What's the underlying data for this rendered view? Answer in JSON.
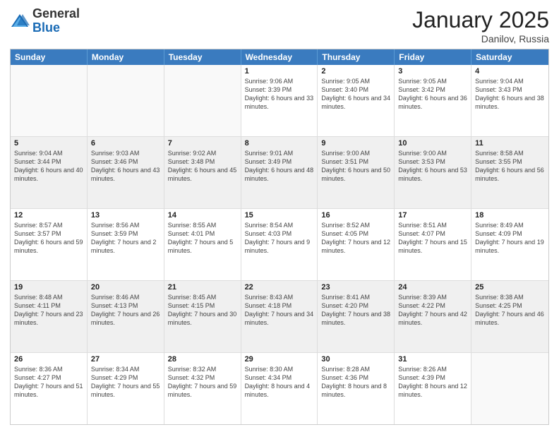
{
  "header": {
    "logo_general": "General",
    "logo_blue": "Blue",
    "month_title": "January 2025",
    "location": "Danilov, Russia"
  },
  "weekdays": [
    "Sunday",
    "Monday",
    "Tuesday",
    "Wednesday",
    "Thursday",
    "Friday",
    "Saturday"
  ],
  "weeks": [
    [
      {
        "day": "",
        "info": "",
        "empty": true
      },
      {
        "day": "",
        "info": "",
        "empty": true
      },
      {
        "day": "",
        "info": "",
        "empty": true
      },
      {
        "day": "1",
        "info": "Sunrise: 9:06 AM\nSunset: 3:39 PM\nDaylight: 6 hours and 33 minutes."
      },
      {
        "day": "2",
        "info": "Sunrise: 9:05 AM\nSunset: 3:40 PM\nDaylight: 6 hours and 34 minutes."
      },
      {
        "day": "3",
        "info": "Sunrise: 9:05 AM\nSunset: 3:42 PM\nDaylight: 6 hours and 36 minutes."
      },
      {
        "day": "4",
        "info": "Sunrise: 9:04 AM\nSunset: 3:43 PM\nDaylight: 6 hours and 38 minutes."
      }
    ],
    [
      {
        "day": "5",
        "info": "Sunrise: 9:04 AM\nSunset: 3:44 PM\nDaylight: 6 hours and 40 minutes.",
        "shaded": true
      },
      {
        "day": "6",
        "info": "Sunrise: 9:03 AM\nSunset: 3:46 PM\nDaylight: 6 hours and 43 minutes.",
        "shaded": true
      },
      {
        "day": "7",
        "info": "Sunrise: 9:02 AM\nSunset: 3:48 PM\nDaylight: 6 hours and 45 minutes.",
        "shaded": true
      },
      {
        "day": "8",
        "info": "Sunrise: 9:01 AM\nSunset: 3:49 PM\nDaylight: 6 hours and 48 minutes.",
        "shaded": true
      },
      {
        "day": "9",
        "info": "Sunrise: 9:00 AM\nSunset: 3:51 PM\nDaylight: 6 hours and 50 minutes.",
        "shaded": true
      },
      {
        "day": "10",
        "info": "Sunrise: 9:00 AM\nSunset: 3:53 PM\nDaylight: 6 hours and 53 minutes.",
        "shaded": true
      },
      {
        "day": "11",
        "info": "Sunrise: 8:58 AM\nSunset: 3:55 PM\nDaylight: 6 hours and 56 minutes.",
        "shaded": true
      }
    ],
    [
      {
        "day": "12",
        "info": "Sunrise: 8:57 AM\nSunset: 3:57 PM\nDaylight: 6 hours and 59 minutes."
      },
      {
        "day": "13",
        "info": "Sunrise: 8:56 AM\nSunset: 3:59 PM\nDaylight: 7 hours and 2 minutes."
      },
      {
        "day": "14",
        "info": "Sunrise: 8:55 AM\nSunset: 4:01 PM\nDaylight: 7 hours and 5 minutes."
      },
      {
        "day": "15",
        "info": "Sunrise: 8:54 AM\nSunset: 4:03 PM\nDaylight: 7 hours and 9 minutes."
      },
      {
        "day": "16",
        "info": "Sunrise: 8:52 AM\nSunset: 4:05 PM\nDaylight: 7 hours and 12 minutes."
      },
      {
        "day": "17",
        "info": "Sunrise: 8:51 AM\nSunset: 4:07 PM\nDaylight: 7 hours and 15 minutes."
      },
      {
        "day": "18",
        "info": "Sunrise: 8:49 AM\nSunset: 4:09 PM\nDaylight: 7 hours and 19 minutes."
      }
    ],
    [
      {
        "day": "19",
        "info": "Sunrise: 8:48 AM\nSunset: 4:11 PM\nDaylight: 7 hours and 23 minutes.",
        "shaded": true
      },
      {
        "day": "20",
        "info": "Sunrise: 8:46 AM\nSunset: 4:13 PM\nDaylight: 7 hours and 26 minutes.",
        "shaded": true
      },
      {
        "day": "21",
        "info": "Sunrise: 8:45 AM\nSunset: 4:15 PM\nDaylight: 7 hours and 30 minutes.",
        "shaded": true
      },
      {
        "day": "22",
        "info": "Sunrise: 8:43 AM\nSunset: 4:18 PM\nDaylight: 7 hours and 34 minutes.",
        "shaded": true
      },
      {
        "day": "23",
        "info": "Sunrise: 8:41 AM\nSunset: 4:20 PM\nDaylight: 7 hours and 38 minutes.",
        "shaded": true
      },
      {
        "day": "24",
        "info": "Sunrise: 8:39 AM\nSunset: 4:22 PM\nDaylight: 7 hours and 42 minutes.",
        "shaded": true
      },
      {
        "day": "25",
        "info": "Sunrise: 8:38 AM\nSunset: 4:25 PM\nDaylight: 7 hours and 46 minutes.",
        "shaded": true
      }
    ],
    [
      {
        "day": "26",
        "info": "Sunrise: 8:36 AM\nSunset: 4:27 PM\nDaylight: 7 hours and 51 minutes."
      },
      {
        "day": "27",
        "info": "Sunrise: 8:34 AM\nSunset: 4:29 PM\nDaylight: 7 hours and 55 minutes."
      },
      {
        "day": "28",
        "info": "Sunrise: 8:32 AM\nSunset: 4:32 PM\nDaylight: 7 hours and 59 minutes."
      },
      {
        "day": "29",
        "info": "Sunrise: 8:30 AM\nSunset: 4:34 PM\nDaylight: 8 hours and 4 minutes."
      },
      {
        "day": "30",
        "info": "Sunrise: 8:28 AM\nSunset: 4:36 PM\nDaylight: 8 hours and 8 minutes."
      },
      {
        "day": "31",
        "info": "Sunrise: 8:26 AM\nSunset: 4:39 PM\nDaylight: 8 hours and 12 minutes."
      },
      {
        "day": "",
        "info": "",
        "empty": true
      }
    ]
  ]
}
